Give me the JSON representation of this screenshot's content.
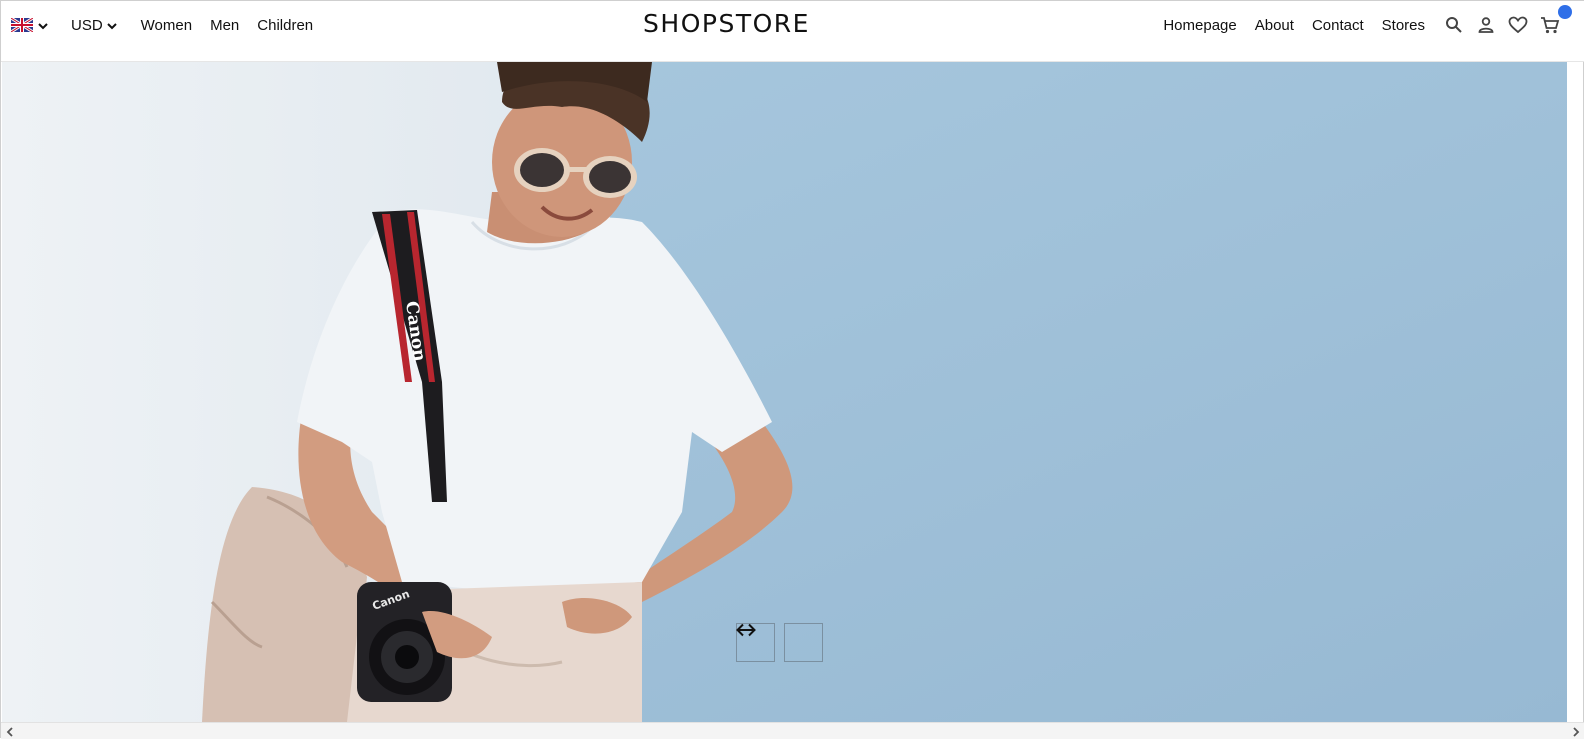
{
  "navbar": {
    "language": {
      "flag_icon": "uk-flag-icon"
    },
    "currency": {
      "label": "USD"
    },
    "left_links": [
      {
        "label": "Women"
      },
      {
        "label": "Men"
      },
      {
        "label": "Children"
      }
    ],
    "brand": "SHOPSTORE",
    "right_links": [
      {
        "label": "Homepage"
      },
      {
        "label": "About"
      },
      {
        "label": "Contact"
      },
      {
        "label": "Stores"
      }
    ],
    "icons": [
      "search-icon",
      "user-icon",
      "heart-icon",
      "cart-icon"
    ],
    "cart_badge_color": "#2f6fe8"
  },
  "hero": {
    "camera_strap_text": "Canon",
    "camera_brand_text": "Canon",
    "wall_color": "#a2c2da",
    "left_wall_color": "#e6ebf0"
  },
  "slider": {
    "prev_icon": "arrow-left-icon",
    "next_icon": "arrow-right-icon"
  }
}
